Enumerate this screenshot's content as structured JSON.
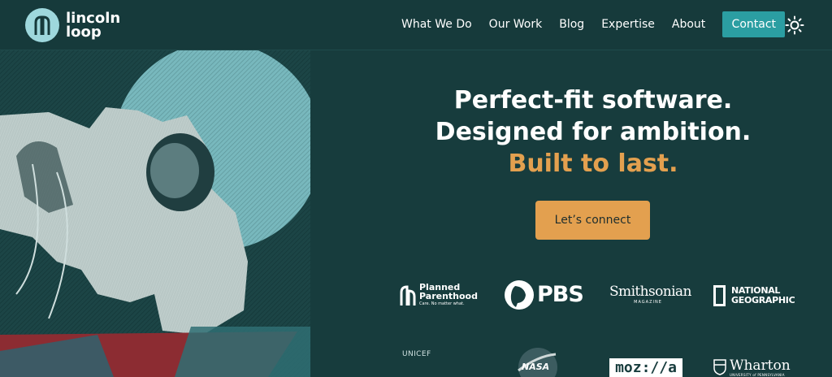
{
  "brand": {
    "line1": "lincoln",
    "line2": "loop"
  },
  "nav": {
    "items": [
      "What We Do",
      "Our Work",
      "Blog",
      "Expertise",
      "About"
    ],
    "contact": "Contact"
  },
  "hero": {
    "line1": "Perfect-fit software.",
    "line2": "Designed for ambition.",
    "line3": "Built to last.",
    "cta": "Let’s connect"
  },
  "clients": {
    "planned_parenthood": {
      "name1": "Planned",
      "name2": "Parenthood",
      "tagline": "Care. No matter what."
    },
    "pbs": "PBS",
    "smithsonian": {
      "name": "Smithsonian",
      "sub": "MAGAZINE"
    },
    "natgeo": {
      "line1": "NATIONAL",
      "line2": "GEOGRAPHIC"
    },
    "unicef": "UNICEF",
    "nasa": "NASA",
    "mozilla": "moz://a",
    "wharton": {
      "name": "Wharton",
      "sub": "UNIVERSITY of PENNSYLVANIA"
    }
  },
  "colors": {
    "background": "#173c3d",
    "accent": "#e3a04f",
    "teal": "#2b9ea2"
  }
}
